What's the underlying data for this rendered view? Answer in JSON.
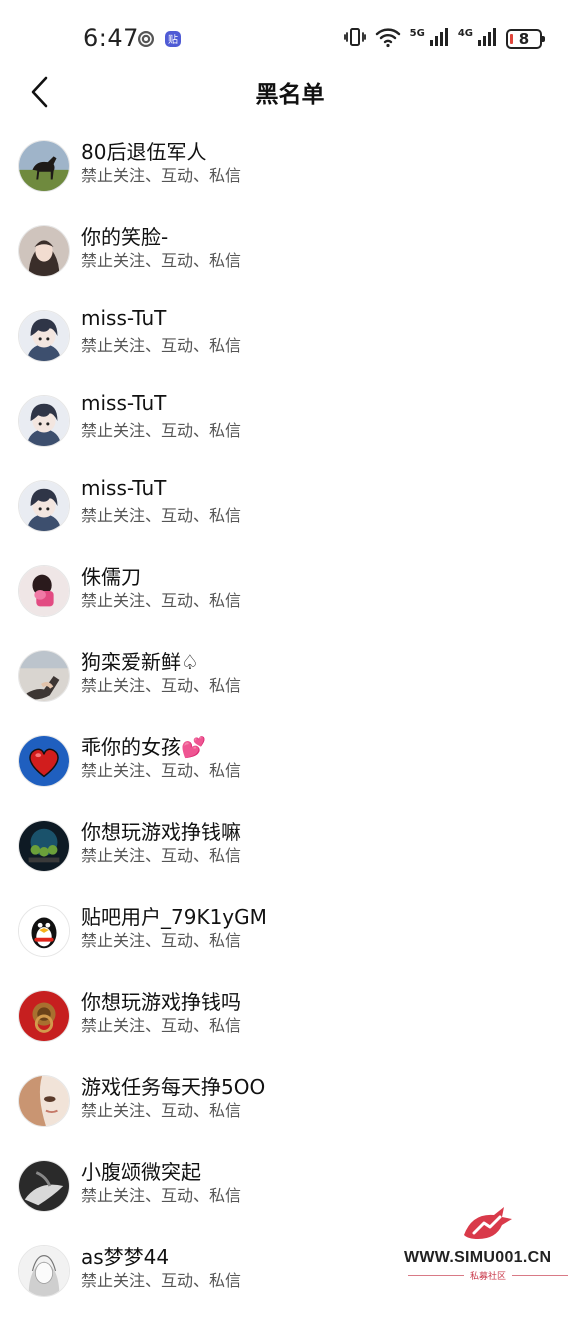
{
  "status_bar": {
    "time": "6:47",
    "network_5g": "5G",
    "network_4g": "4G",
    "battery": "8"
  },
  "header": {
    "title": "黑名单"
  },
  "blacklist": [
    {
      "name": "80后退伍军人",
      "subtitle": "禁止关注、互动、私信",
      "avatar": "horse-avatar"
    },
    {
      "name": "你的笑脸-",
      "subtitle": "禁止关注、互动、私信",
      "avatar": "girl-photo-avatar"
    },
    {
      "name": "miss-TuT",
      "subtitle": "禁止关注、互动、私信",
      "avatar": "anime-boy-avatar"
    },
    {
      "name": "miss-TuT",
      "subtitle": "禁止关注、互动、私信",
      "avatar": "anime-boy-avatar"
    },
    {
      "name": "miss-TuT",
      "subtitle": "禁止关注、互动、私信",
      "avatar": "anime-boy-avatar"
    },
    {
      "name": "侏儒刀",
      "subtitle": "禁止关注、互动、私信",
      "avatar": "pink-photo-avatar"
    },
    {
      "name": "狗栾爱新鲜♤",
      "subtitle": "禁止关注、互动、私信",
      "avatar": "hand-photo-avatar"
    },
    {
      "name": "乖你的女孩💕",
      "subtitle": "禁止关注、互动、私信",
      "avatar": "red-heart-avatar"
    },
    {
      "name": "你想玩游戏挣钱嘛",
      "subtitle": "禁止关注、互动、私信",
      "avatar": "game-avatar"
    },
    {
      "name": "贴吧用户_79K1yGM",
      "subtitle": "禁止关注、互动、私信",
      "avatar": "penguin-avatar"
    },
    {
      "name": "你想玩游戏挣钱吗",
      "subtitle": "禁止关注、互动、私信",
      "avatar": "door-knocker-avatar"
    },
    {
      "name": "游戏任务每天挣5OO",
      "subtitle": "禁止关注、互动、私信",
      "avatar": "face-photo-avatar"
    },
    {
      "name": "小腹颂微突起",
      "subtitle": "禁止关注、互动、私信",
      "avatar": "dark-photo-avatar"
    },
    {
      "name": "as梦梦44",
      "subtitle": "禁止关注、互动、私信",
      "avatar": "sketch-girl-avatar"
    }
  ],
  "watermark": {
    "text": "WWW.SIMU001.CN",
    "sub": "私募社区"
  },
  "colors": {
    "accent_red": "#d93a4a",
    "subtitle_gray": "#555555"
  }
}
